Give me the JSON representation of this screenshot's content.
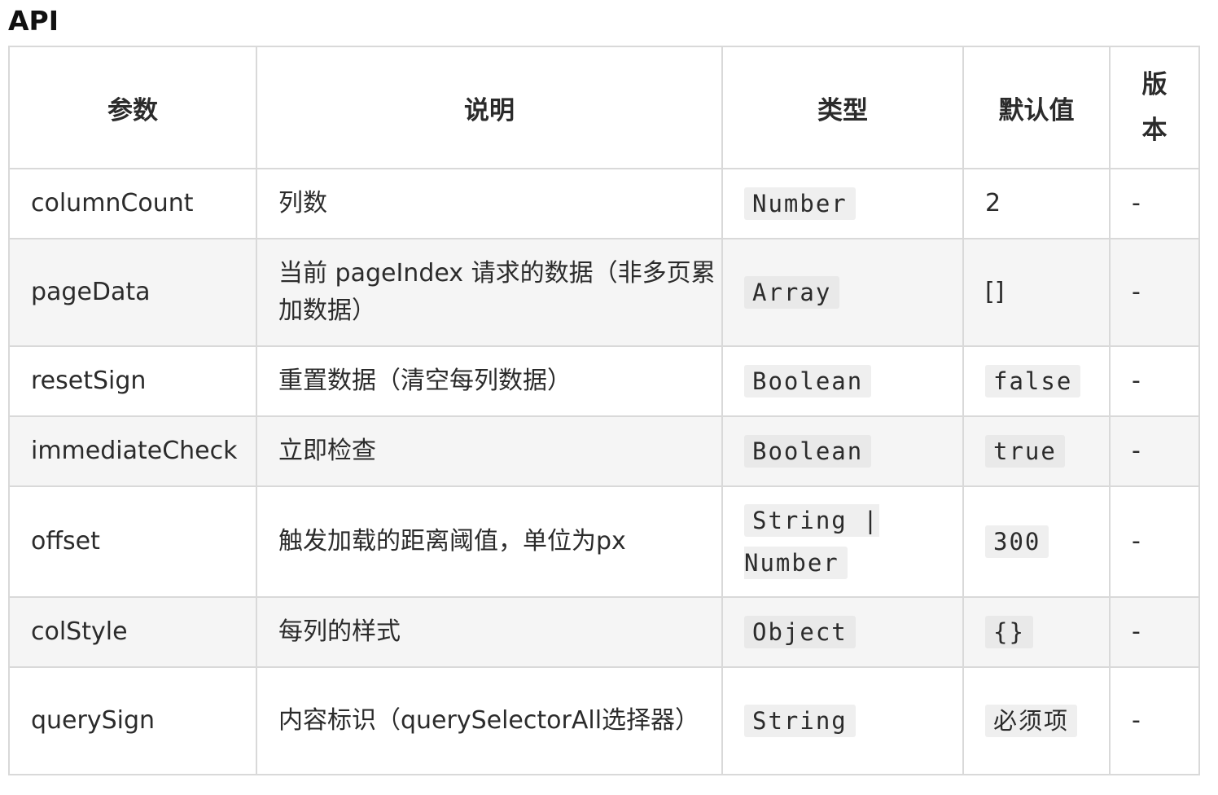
{
  "heading": "API",
  "table": {
    "headers": [
      "参数",
      "说明",
      "类型",
      "默认值",
      "版本"
    ],
    "rows": [
      {
        "param": "columnCount",
        "desc": "列数",
        "type": "Number",
        "default": "2",
        "default_is_code": false,
        "version": "-"
      },
      {
        "param": "pageData",
        "desc": "当前 pageIndex 请求的数据（非多页累加数据）",
        "type": "Array",
        "default": "[]",
        "default_is_code": false,
        "version": "-"
      },
      {
        "param": "resetSign",
        "desc": "重置数据（清空每列数据）",
        "type": "Boolean",
        "default": "false",
        "default_is_code": true,
        "version": "-"
      },
      {
        "param": "immediateCheck",
        "desc": "立即检查",
        "type": "Boolean",
        "default": "true",
        "default_is_code": true,
        "version": "-"
      },
      {
        "param": "offset",
        "desc": "触发加载的距离阈值，单位为px",
        "type": "String | Number",
        "default": "300",
        "default_is_code": true,
        "version": "-"
      },
      {
        "param": "colStyle",
        "desc": "每列的样式",
        "type": "Object",
        "default": "{}",
        "default_is_code": true,
        "version": "-"
      },
      {
        "param": "querySign",
        "desc": "内容标识（querySelectorAll选择器）",
        "type": "String",
        "default": "必须项",
        "default_is_code": true,
        "version": "-"
      }
    ]
  }
}
